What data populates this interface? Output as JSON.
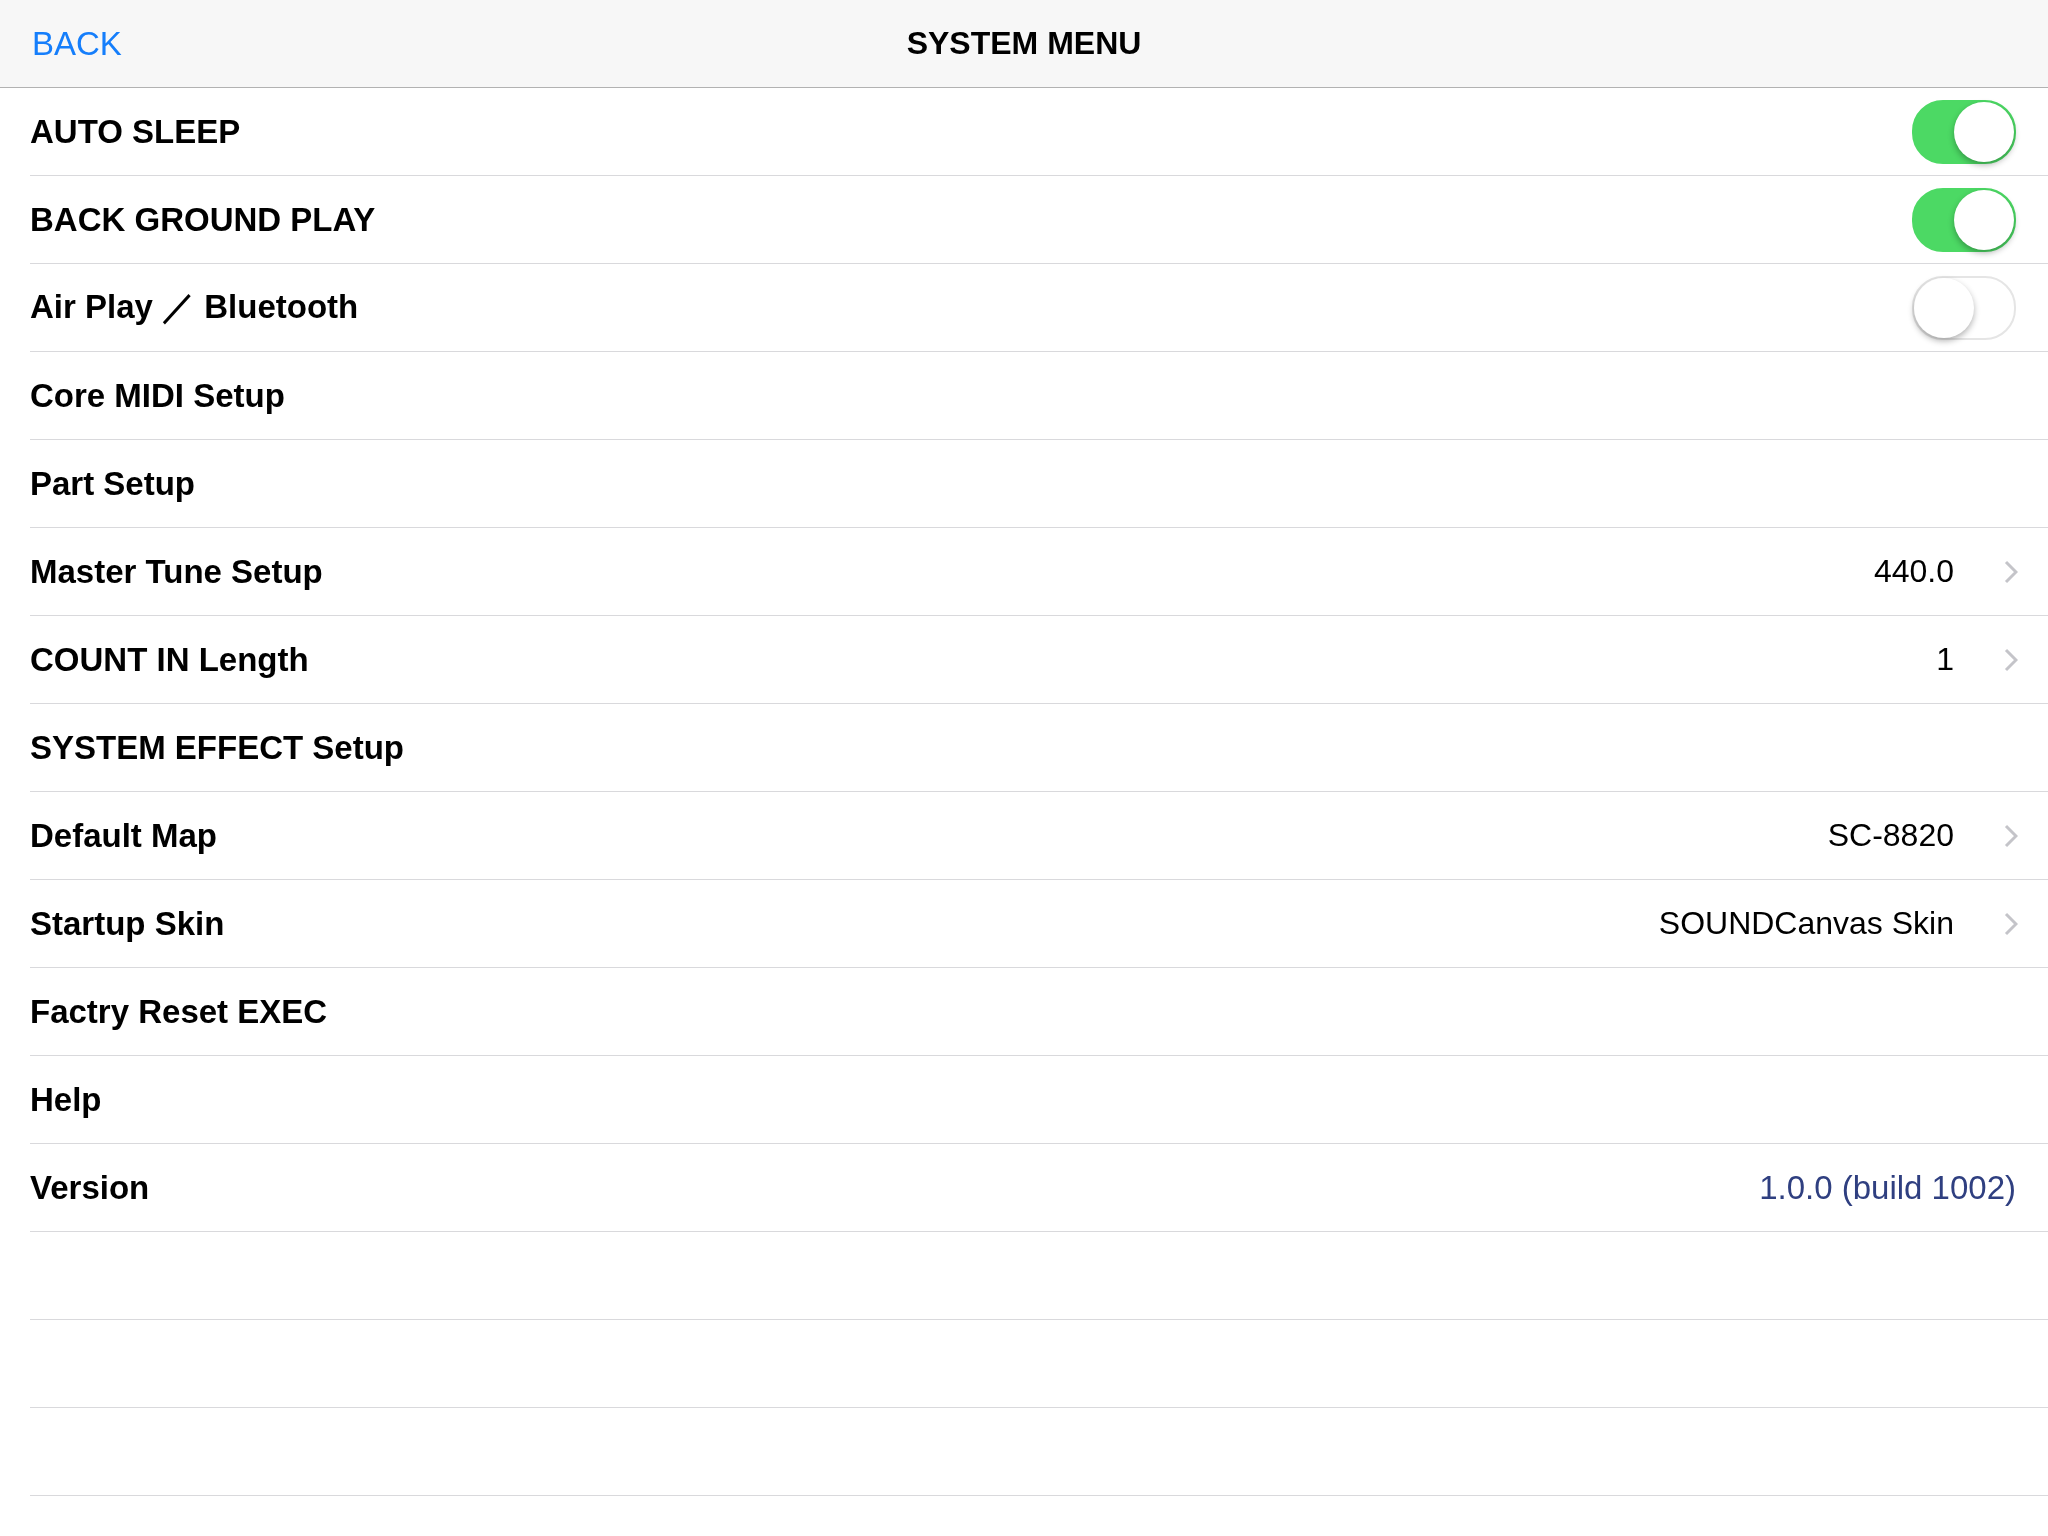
{
  "nav_bar": {
    "back": "BACK",
    "title": "SYSTEM MENU"
  },
  "rows": [
    {
      "kind": "toggle",
      "label": "AUTO SLEEP",
      "on": true
    },
    {
      "kind": "toggle",
      "label": "BACK GROUND PLAY",
      "on": true
    },
    {
      "kind": "toggle",
      "label": "Air Play ／ Bluetooth",
      "on": false
    },
    {
      "kind": "plain",
      "label": "Core MIDI Setup"
    },
    {
      "kind": "plain",
      "label": "Part Setup"
    },
    {
      "kind": "value",
      "label": "Master Tune Setup",
      "value": "440.0"
    },
    {
      "kind": "value",
      "label": "COUNT IN Length",
      "value": "1"
    },
    {
      "kind": "plain",
      "label": "SYSTEM EFFECT Setup"
    },
    {
      "kind": "value",
      "label": "Default Map",
      "value": "SC-8820"
    },
    {
      "kind": "value",
      "label": "Startup Skin",
      "value": "SOUNDCanvas Skin"
    },
    {
      "kind": "plain",
      "label": "Factry Reset EXEC"
    },
    {
      "kind": "plain",
      "label": "Help"
    },
    {
      "kind": "info",
      "label": "Version",
      "value": "1.0.0 (build 1002)"
    }
  ]
}
